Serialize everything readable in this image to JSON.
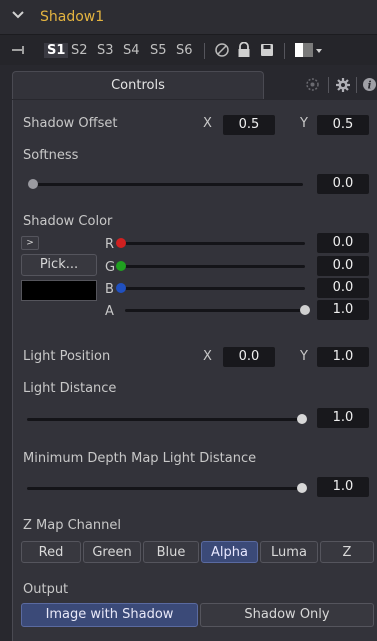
{
  "header": {
    "title": "Shadow1"
  },
  "toolbar": {
    "slots": [
      "S1",
      "S2",
      "S3",
      "S4",
      "S5",
      "S6"
    ],
    "active_slot": "S1"
  },
  "tabs": {
    "controls_label": "Controls"
  },
  "controls": {
    "shadow_offset": {
      "label": "Shadow Offset",
      "x_label": "X",
      "x": "0.5",
      "y_label": "Y",
      "y": "0.5"
    },
    "softness": {
      "label": "Softness",
      "value": "0.0",
      "level": 0.0
    },
    "shadow_color": {
      "label": "Shadow Color",
      "expand_label": ">",
      "pick_label": "Pick...",
      "swatch": "#000000",
      "r": {
        "label": "R",
        "value": "0.0",
        "level": 0.0,
        "color": "#d02020"
      },
      "g": {
        "label": "G",
        "value": "0.0",
        "level": 0.0,
        "color": "#20a020"
      },
      "b": {
        "label": "B",
        "value": "0.0",
        "level": 0.0,
        "color": "#2050c0"
      },
      "a": {
        "label": "A",
        "value": "1.0",
        "level": 1.0,
        "color": "#d0d0d0"
      }
    },
    "light_position": {
      "label": "Light Position",
      "x_label": "X",
      "x": "0.0",
      "y_label": "Y",
      "y": "1.0"
    },
    "light_distance": {
      "label": "Light Distance",
      "value": "1.0",
      "level": 1.0
    },
    "min_depth": {
      "label": "Minimum Depth Map Light Distance",
      "value": "1.0",
      "level": 1.0
    },
    "z_map_channel": {
      "label": "Z Map Channel",
      "options": [
        "Red",
        "Green",
        "Blue",
        "Alpha",
        "Luma",
        "Z"
      ],
      "selected": "Alpha"
    },
    "output": {
      "label": "Output",
      "options": [
        "Image with Shadow",
        "Shadow Only"
      ],
      "selected": "Image with Shadow"
    }
  }
}
